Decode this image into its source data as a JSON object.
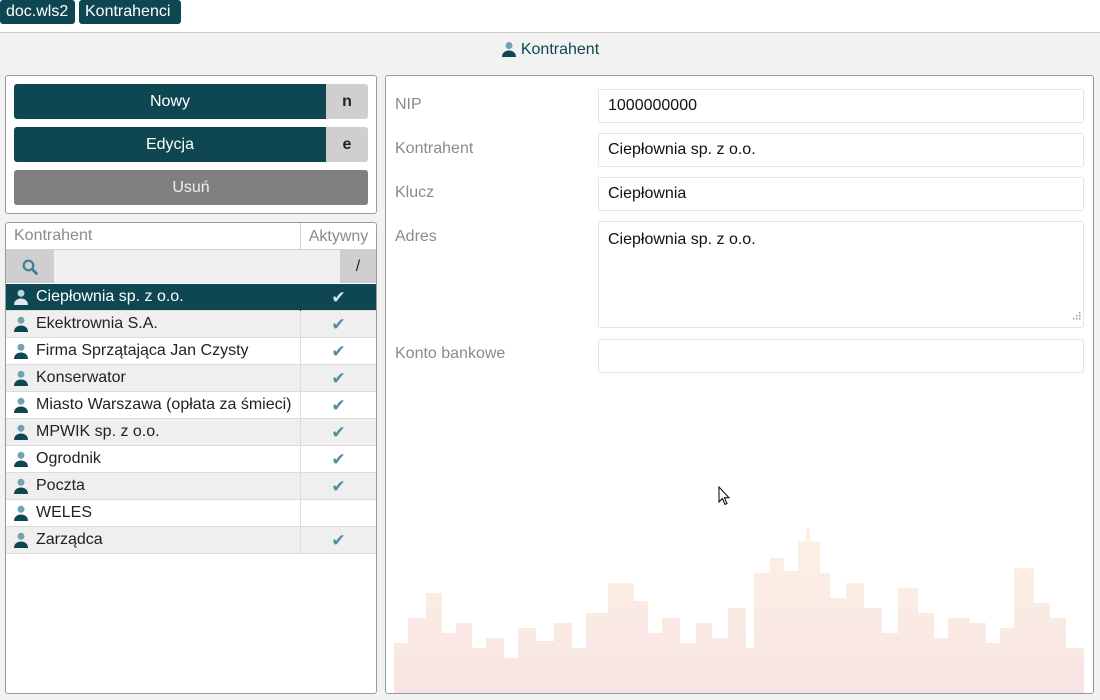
{
  "breadcrumb": {
    "items": [
      "doc.wls2",
      "Kontrahenci"
    ]
  },
  "header": {
    "title": "Kontrahent"
  },
  "actions": {
    "new_label": "Nowy",
    "new_key": "n",
    "edit_label": "Edycja",
    "edit_key": "e",
    "delete_label": "Usuń"
  },
  "list": {
    "col_name": "Kontrahent",
    "col_active": "Aktywny",
    "filter_symbol": "/",
    "search_value": "",
    "rows": [
      {
        "name": "Ciepłownia sp. z o.o.",
        "active": "✔"
      },
      {
        "name": "Ekektrownia S.A.",
        "active": "✔"
      },
      {
        "name": "Firma Sprzątająca Jan Czysty",
        "active": "✔"
      },
      {
        "name": "Konserwator",
        "active": "✔"
      },
      {
        "name": "Miasto Warszawa (opłata za śmieci)",
        "active": "✔"
      },
      {
        "name": "MPWIK sp. z o.o.",
        "active": "✔"
      },
      {
        "name": "Ogrodnik",
        "active": "✔"
      },
      {
        "name": "Poczta",
        "active": "✔"
      },
      {
        "name": "WELES",
        "active": ""
      },
      {
        "name": "Zarządca",
        "active": "✔"
      }
    ]
  },
  "form": {
    "nip_label": "NIP",
    "nip_value": "1000000000",
    "name_label": "Kontrahent",
    "name_value": "Ciepłownia sp. z o.o.",
    "key_label": "Klucz",
    "key_value": "Ciepłownia",
    "address_label": "Adres",
    "address_value": "Ciepłownia sp. z o.o.",
    "bank_label": "Konto bankowe",
    "bank_value": ""
  },
  "colors": {
    "accent": "#0e4752",
    "muted_button": "#808080",
    "check": "#4f8ea0"
  }
}
